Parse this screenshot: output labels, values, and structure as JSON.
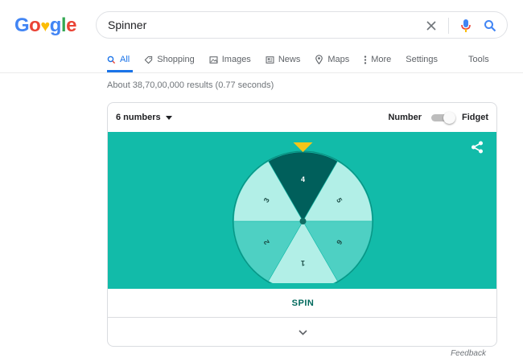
{
  "logo": {
    "letters": [
      "G",
      "o",
      "♥",
      "g",
      "l",
      "e"
    ],
    "colors": [
      "#4285f4",
      "#ea4335",
      "#fbbc05",
      "#4285f4",
      "#34a853",
      "#ea4335"
    ]
  },
  "search": {
    "query": "Spinner",
    "placeholder": ""
  },
  "tabs": [
    {
      "label": "All",
      "icon": "search-icon",
      "active": true
    },
    {
      "label": "Shopping",
      "icon": "tag-icon"
    },
    {
      "label": "Images",
      "icon": "image-icon"
    },
    {
      "label": "News",
      "icon": "newspaper-icon"
    },
    {
      "label": "Maps",
      "icon": "map-pin-icon"
    },
    {
      "label": "More",
      "icon": "more-vert-icon"
    }
  ],
  "tools": {
    "settings": "Settings",
    "tools": "Tools"
  },
  "results_stats": "About 38,70,00,000 results (0.77 seconds)",
  "spinner": {
    "dropdown_label": "6 numbers",
    "mode_left": "Number",
    "mode_right": "Fidget",
    "mode": "Number",
    "segments": [
      "4",
      "5",
      "6",
      "1",
      "2",
      "3"
    ],
    "selected": "4",
    "spin_label": "SPIN",
    "colors": {
      "stage": "#12bba9",
      "selected": "#005f5b",
      "light": "#b2efe7",
      "medium": "#4ed0c3",
      "pointer": "#f5c518"
    }
  },
  "feedback": "Feedback"
}
